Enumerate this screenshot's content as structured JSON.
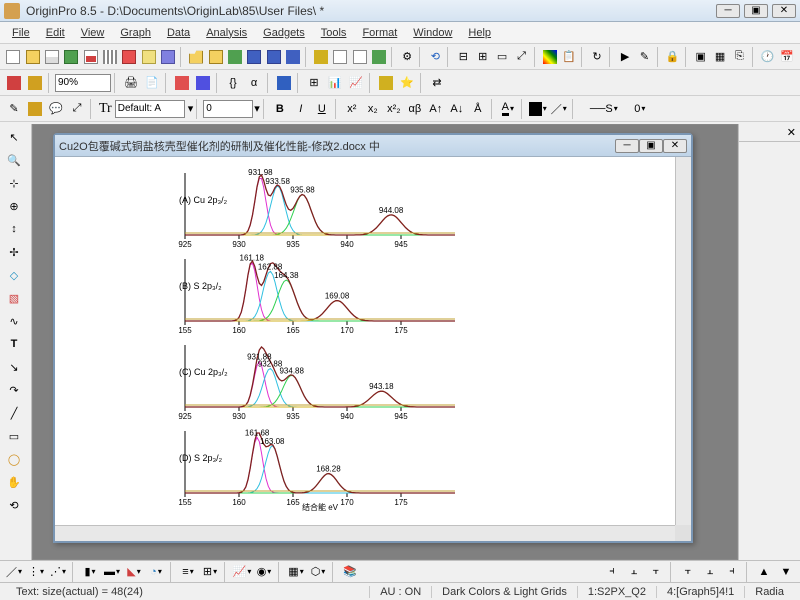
{
  "app": {
    "title": "OriginPro 8.5 - D:\\Documents\\OriginLab\\85\\User Files\\ *"
  },
  "menu": [
    "File",
    "Edit",
    "View",
    "Graph",
    "Data",
    "Analysis",
    "Gadgets",
    "Tools",
    "Format",
    "Window",
    "Help"
  ],
  "toolbar2": {
    "zoom": "90%"
  },
  "format_bar": {
    "font": "Default: A",
    "size": "0",
    "line_style": "S"
  },
  "doc": {
    "title": "Cu2O包覆碱式铜盐核壳型催化剂的研制及催化性能-修改2.docx 中"
  },
  "status": {
    "text": "Text: size(actual) = 48(24)",
    "au": "AU : ON",
    "theme": "Dark Colors & Light Grids",
    "sel1": "1:S2PX_Q2",
    "sel2": "4:[Graph5]4!1",
    "mode": "Radia"
  },
  "axis_label": "结合能 eV",
  "chart_data": [
    {
      "type": "line",
      "label": "(A) Cu 2p₃/₂",
      "xrange": [
        925,
        950
      ],
      "xticks": [
        925,
        930,
        935,
        940,
        945
      ],
      "peaks": [
        {
          "x": 931.98,
          "label": "931.98"
        },
        {
          "x": 933.58,
          "label": "933.58"
        },
        {
          "x": 935.88,
          "label": "935.88"
        },
        {
          "x": 944.08,
          "label": "944.08"
        }
      ],
      "series": [
        {
          "name": "raw",
          "color": "#c92020"
        },
        {
          "name": "fit1",
          "color": "#e030d0"
        },
        {
          "name": "fit2",
          "color": "#30c0e0"
        },
        {
          "name": "fit3",
          "color": "#30d050"
        },
        {
          "name": "baseline",
          "color": "#d0b020"
        }
      ]
    },
    {
      "type": "line",
      "label": "(B) S 2p₃/₂",
      "xrange": [
        155,
        180
      ],
      "xticks": [
        155,
        160,
        165,
        170,
        175
      ],
      "peaks": [
        {
          "x": 161.18,
          "label": "161.18"
        },
        {
          "x": 162.88,
          "label": "162.88"
        },
        {
          "x": 164.38,
          "label": "164.38"
        },
        {
          "x": 169.08,
          "label": "169.08"
        }
      ],
      "series": [
        {
          "name": "raw",
          "color": "#c92020"
        },
        {
          "name": "fit1",
          "color": "#e030d0"
        },
        {
          "name": "fit2",
          "color": "#30c0e0"
        },
        {
          "name": "fit3",
          "color": "#30d050"
        },
        {
          "name": "baseline",
          "color": "#d0b020"
        }
      ]
    },
    {
      "type": "line",
      "label": "(C) Cu 2p₃/₂",
      "xrange": [
        925,
        950
      ],
      "xticks": [
        925,
        930,
        935,
        940,
        945
      ],
      "peaks": [
        {
          "x": 931.88,
          "label": "931.88"
        },
        {
          "x": 932.88,
          "label": "932.88"
        },
        {
          "x": 934.88,
          "label": "934.88"
        },
        {
          "x": 943.18,
          "label": "943.18"
        }
      ],
      "series": [
        {
          "name": "raw",
          "color": "#c92020"
        },
        {
          "name": "fit1",
          "color": "#e030d0"
        },
        {
          "name": "fit2",
          "color": "#30c0e0"
        },
        {
          "name": "fit3",
          "color": "#30d050"
        },
        {
          "name": "baseline",
          "color": "#d0b020"
        }
      ]
    },
    {
      "type": "line",
      "label": "(D) S 2p₃/₂",
      "xrange": [
        155,
        180
      ],
      "xticks": [
        155,
        160,
        165,
        170,
        175
      ],
      "peaks": [
        {
          "x": 161.68,
          "label": "161.68"
        },
        {
          "x": 163.08,
          "label": "163.08"
        },
        {
          "x": 168.28,
          "label": "168.28"
        }
      ],
      "series": [
        {
          "name": "raw",
          "color": "#c92020"
        },
        {
          "name": "fit1",
          "color": "#e030d0"
        },
        {
          "name": "fit2",
          "color": "#30c0e0"
        },
        {
          "name": "fit3",
          "color": "#30d050"
        },
        {
          "name": "baseline",
          "color": "#d0b020"
        }
      ]
    }
  ]
}
